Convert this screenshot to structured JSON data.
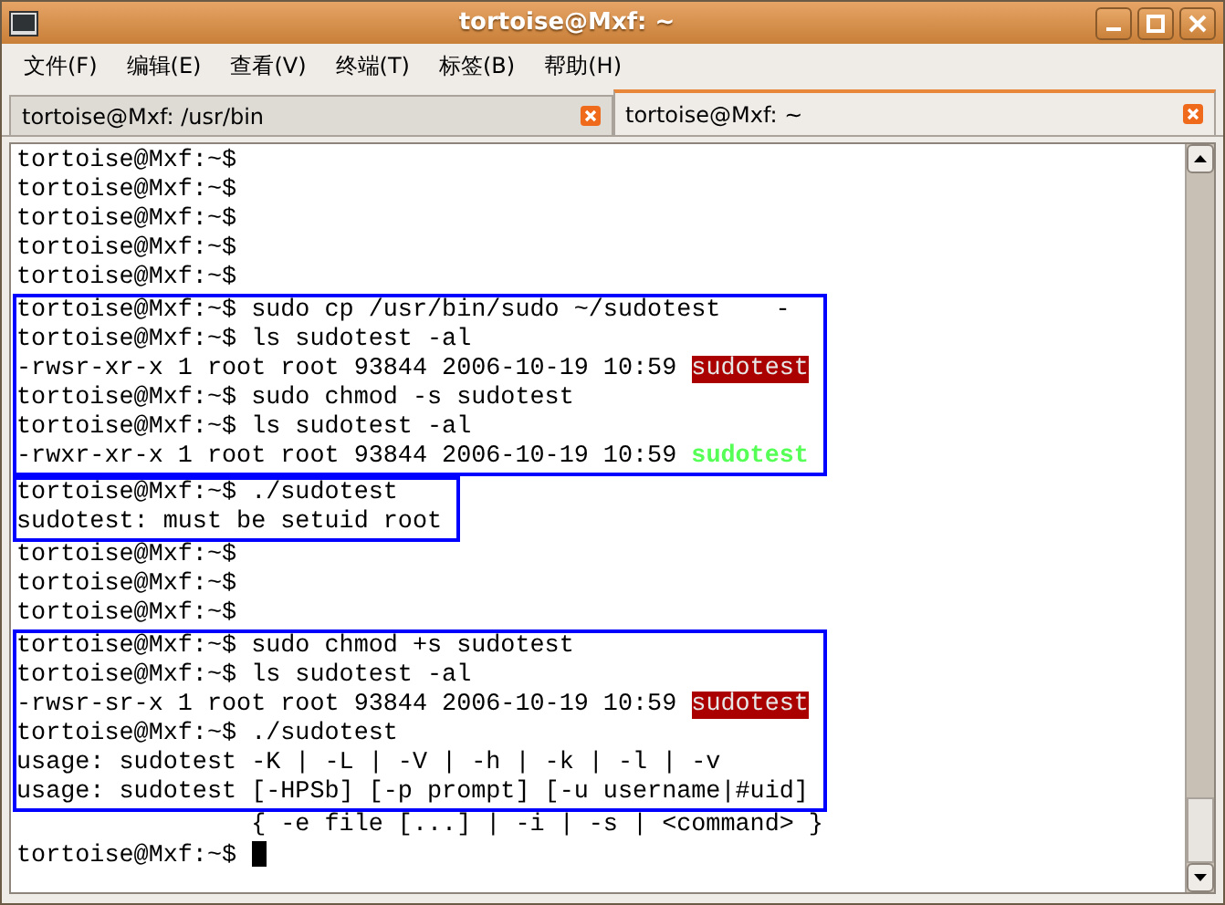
{
  "window": {
    "title": "tortoise@Mxf: ~"
  },
  "menu": [
    "文件(F)",
    "编辑(E)",
    "查看(V)",
    "终端(T)",
    "标签(B)",
    "帮助(H)"
  ],
  "tabs": [
    {
      "label": "tortoise@Mxf: /usr/bin",
      "selected": false
    },
    {
      "label": "tortoise@Mxf: ~",
      "selected": true
    }
  ],
  "terminal": {
    "blocks": [
      {
        "boxed": false,
        "lines": [
          {
            "text": "tortoise@Mxf:~$"
          },
          {
            "text": "tortoise@Mxf:~$"
          },
          {
            "text": "tortoise@Mxf:~$"
          },
          {
            "text": "tortoise@Mxf:~$"
          },
          {
            "text": "tortoise@Mxf:~$"
          }
        ]
      },
      {
        "boxed": true,
        "lines": [
          {
            "text": "tortoise@Mxf:~$ sudo cp /usr/bin/sudo ~/sudotest",
            "aside": "-"
          },
          {
            "text": "tortoise@Mxf:~$ ls sudotest -al"
          },
          {
            "text": "-rwsr-xr-x 1 root root 93844 2006-10-19 10:59 ",
            "file": {
              "text": "sudotest",
              "kind": "setuid"
            }
          },
          {
            "text": "tortoise@Mxf:~$ sudo chmod -s sudotest"
          },
          {
            "text": "tortoise@Mxf:~$ ls sudotest -al"
          },
          {
            "text": "-rwxr-xr-x 1 root root 93844 2006-10-19 10:59 ",
            "file": {
              "text": "sudotest",
              "kind": "exec"
            }
          }
        ]
      },
      {
        "boxed": true,
        "lines": [
          {
            "text": "tortoise@Mxf:~$ ./sudotest"
          },
          {
            "text": "sudotest: must be setuid root"
          }
        ]
      },
      {
        "boxed": false,
        "lines": [
          {
            "text": "tortoise@Mxf:~$"
          },
          {
            "text": "tortoise@Mxf:~$"
          },
          {
            "text": "tortoise@Mxf:~$"
          }
        ]
      },
      {
        "boxed": true,
        "lines": [
          {
            "text": "tortoise@Mxf:~$ sudo chmod +s sudotest"
          },
          {
            "text": "tortoise@Mxf:~$ ls sudotest -al"
          },
          {
            "text": "-rwsr-sr-x 1 root root 93844 2006-10-19 10:59 ",
            "file": {
              "text": "sudotest",
              "kind": "setuid"
            }
          },
          {
            "text": "tortoise@Mxf:~$ ./sudotest"
          },
          {
            "text": "usage: sudotest -K | -L | -V | -h | -k | -l | -v"
          },
          {
            "text": "usage: sudotest [-HPSb] [-p prompt] [-u username|#uid]"
          }
        ]
      },
      {
        "boxed": false,
        "lines": [
          {
            "text": "                { -e file [...] | -i | -s | <command> }"
          },
          {
            "text": "tortoise@Mxf:~$ ",
            "cursor": true
          }
        ]
      }
    ]
  }
}
